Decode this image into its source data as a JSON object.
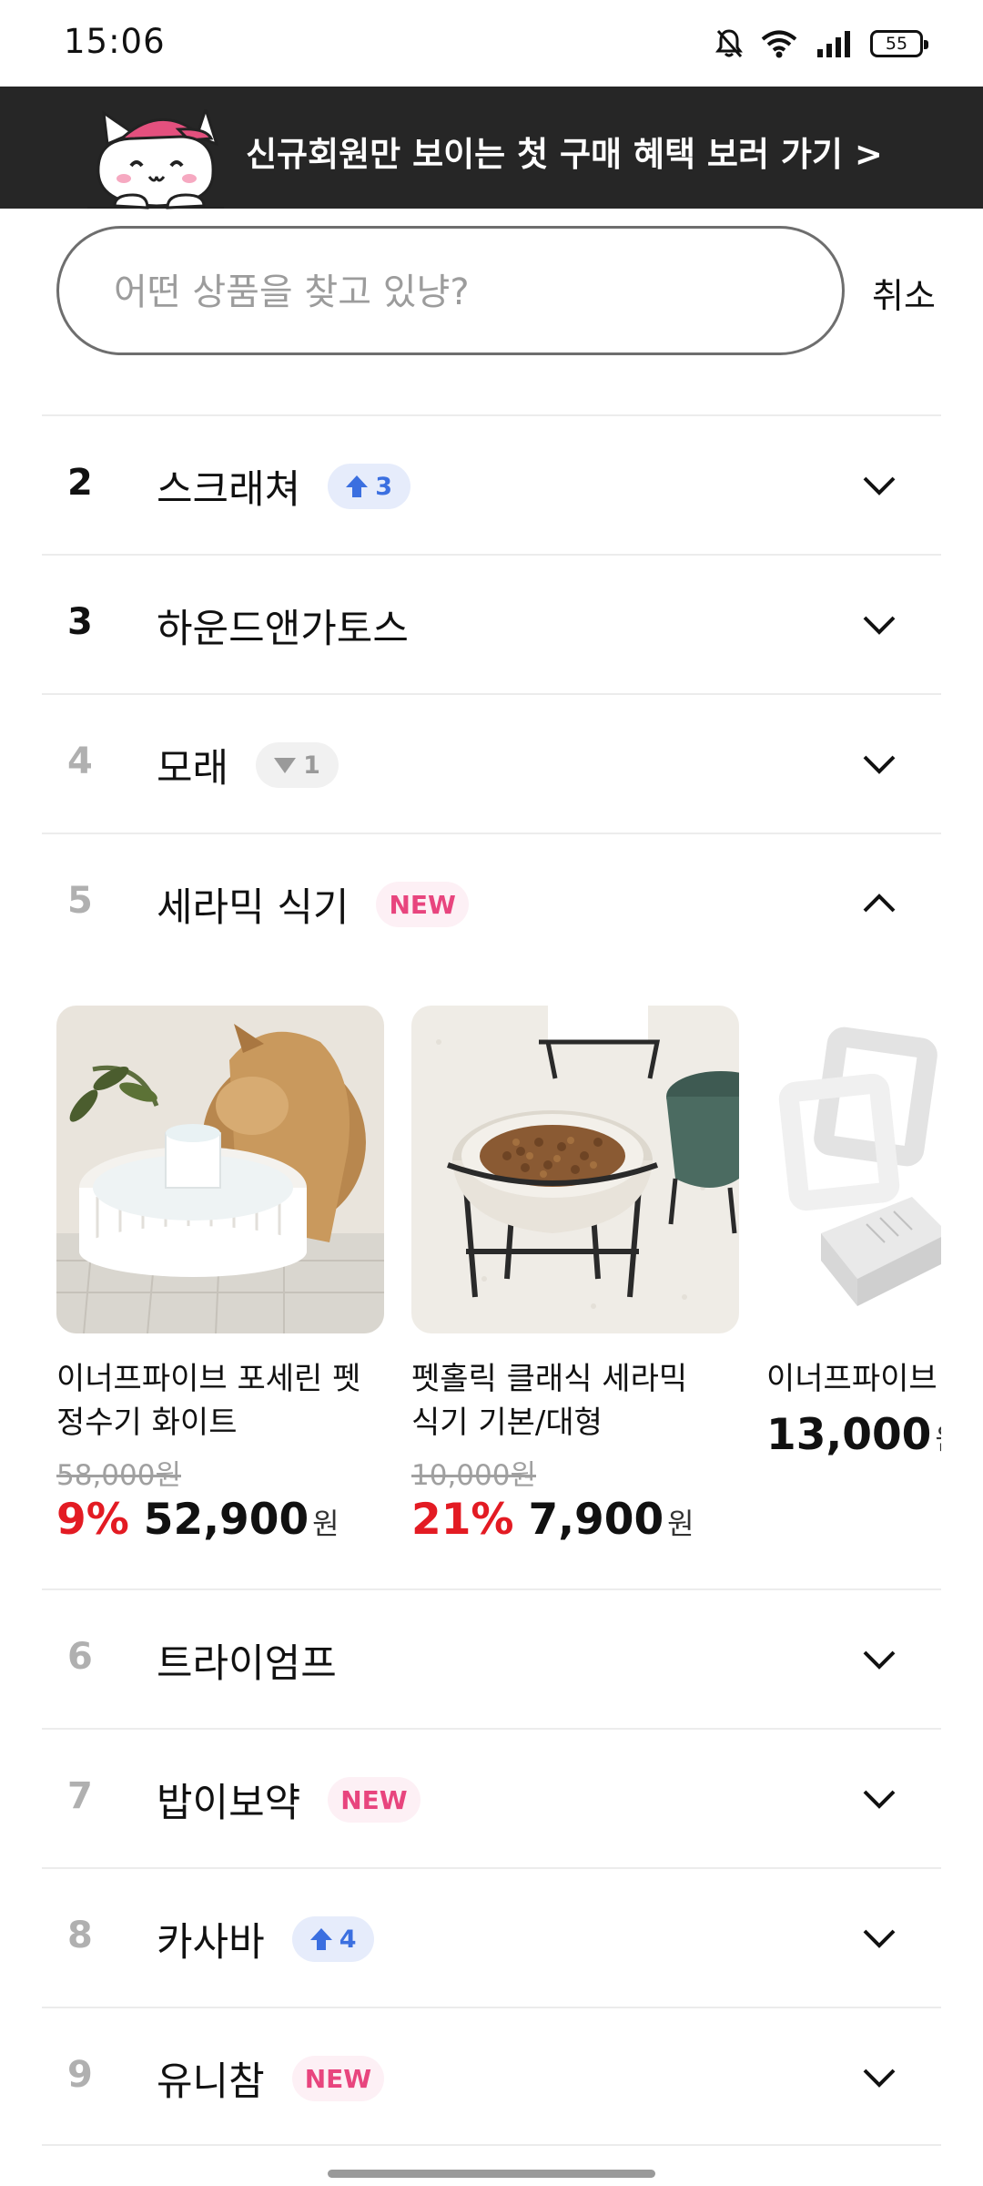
{
  "status_bar": {
    "time": "15:06",
    "battery": "55",
    "icons": [
      "bell-muted-icon",
      "wifi-icon",
      "signal-icon",
      "battery-icon"
    ]
  },
  "promo_banner": {
    "text": "신규회원만 보이는 첫 구매 혜택 보러 가기 >",
    "mascot": "cat-mascot"
  },
  "search": {
    "placeholder": "어떤 상품을 찾고 있냥?",
    "value": "",
    "cancel_label": "취소"
  },
  "ranking": {
    "items": [
      {
        "rank": "2",
        "name": "스크래쳐",
        "badge": {
          "type": "up",
          "value": "3"
        },
        "expanded": false
      },
      {
        "rank": "3",
        "name": "하운드앤가토스",
        "badge": null,
        "expanded": false
      },
      {
        "rank": "4",
        "name": "모래",
        "badge": {
          "type": "down",
          "value": "1"
        },
        "expanded": false
      },
      {
        "rank": "5",
        "name": "세라믹 식기",
        "badge": {
          "type": "new",
          "value": "NEW"
        },
        "expanded": true
      },
      {
        "rank": "6",
        "name": "트라이엄프",
        "badge": null,
        "expanded": false
      },
      {
        "rank": "7",
        "name": "밥이보약",
        "badge": {
          "type": "new",
          "value": "NEW"
        },
        "expanded": false
      },
      {
        "rank": "8",
        "name": "카사바",
        "badge": {
          "type": "up",
          "value": "4"
        },
        "expanded": false
      },
      {
        "rank": "9",
        "name": "유니참",
        "badge": {
          "type": "new",
          "value": "NEW"
        },
        "expanded": false
      }
    ],
    "products": [
      {
        "name": "이너프파이브 포세린 펫 정수기 화이트",
        "original_price": "58,000원",
        "discount": "9%",
        "price": "52,900",
        "currency": "원"
      },
      {
        "name": "펫홀릭 클래식 세라믹 식기 기본/대형",
        "original_price": "10,000원",
        "discount": "21%",
        "price": "7,900",
        "currency": "원"
      },
      {
        "name": "이너프파이브 정수기 필터",
        "original_price": "",
        "discount": "",
        "price": "13,000",
        "currency": "원"
      }
    ]
  },
  "colors": {
    "banner_bg": "#262626",
    "discount_red": "#e31b23",
    "up_blue": "#3b6fe0",
    "new_pink": "#e8457e"
  }
}
